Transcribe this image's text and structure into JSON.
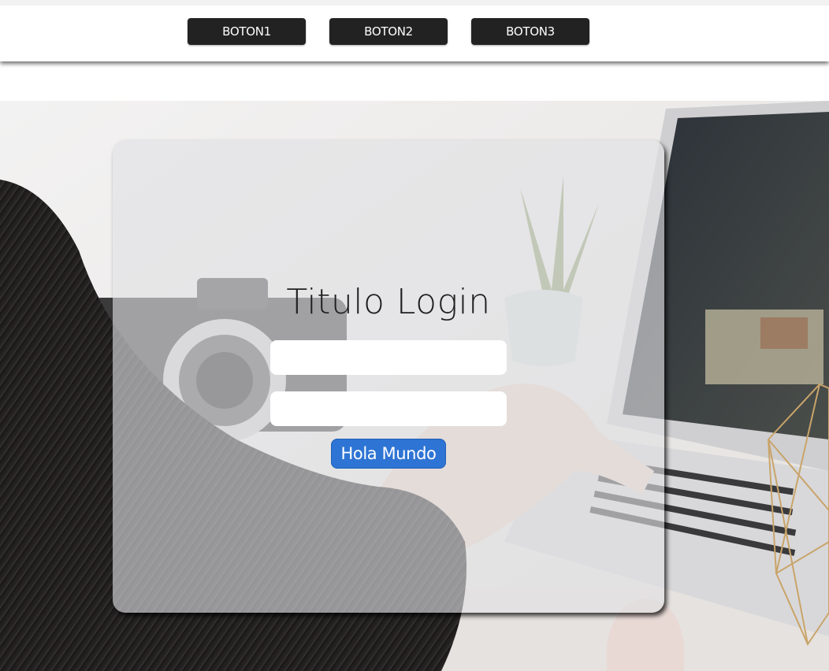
{
  "nav": {
    "buttons": [
      {
        "label": "BOTON1"
      },
      {
        "label": "BOTON2"
      },
      {
        "label": "BOTON3"
      }
    ]
  },
  "login": {
    "title": "Titulo Login",
    "username": {
      "value": "",
      "placeholder": ""
    },
    "password": {
      "value": "",
      "placeholder": ""
    },
    "submit_label": "Hola Mundo"
  },
  "colors": {
    "nav_button": "#222222",
    "submit_button": "#2e74d4",
    "card_overlay": "#e1e1e4"
  }
}
